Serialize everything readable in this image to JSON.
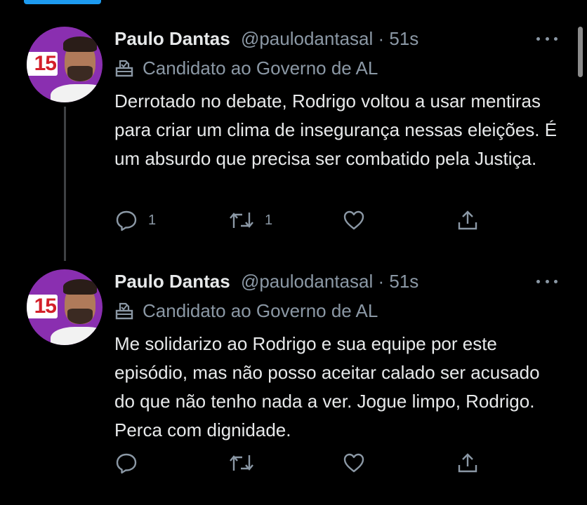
{
  "tweets": [
    {
      "author_name": "Paulo Dantas",
      "handle": "@paulodantasal",
      "separator": " · ",
      "time": "51s",
      "label": "Candidato ao Governo de AL",
      "avatar_badge": "15",
      "text": "Derrotado no debate, Rodrigo voltou a usar mentiras para criar um clima de insegurança nessas eleições. É um absurdo que precisa ser combatido pela Justiça.",
      "reply_count": "1",
      "retweet_count": "1",
      "like_count": "",
      "icons": [
        "ballot-box-icon",
        "more-icon",
        "reply-icon",
        "retweet-icon",
        "like-icon",
        "share-icon"
      ]
    },
    {
      "author_name": "Paulo Dantas",
      "handle": "@paulodantasal",
      "separator": " · ",
      "time": "51s",
      "label": "Candidato ao Governo de AL",
      "avatar_badge": "15",
      "text": "Me solidarizo ao Rodrigo e sua equipe por este episódio, mas não posso aceitar calado ser acusado do que não tenho nada a ver. Jogue limpo, Rodrigo. Perca com dignidade.",
      "reply_count": "",
      "retweet_count": "",
      "like_count": "",
      "icons": [
        "ballot-box-icon",
        "more-icon",
        "reply-icon",
        "retweet-icon",
        "like-icon",
        "share-icon"
      ]
    }
  ],
  "colors": {
    "background": "#000000",
    "text_primary": "#e7e9ea",
    "text_secondary": "#8b98a5",
    "accent": "#1d9bf0",
    "avatar_bg": "#8a2fb0",
    "badge_red": "#d3202a"
  }
}
